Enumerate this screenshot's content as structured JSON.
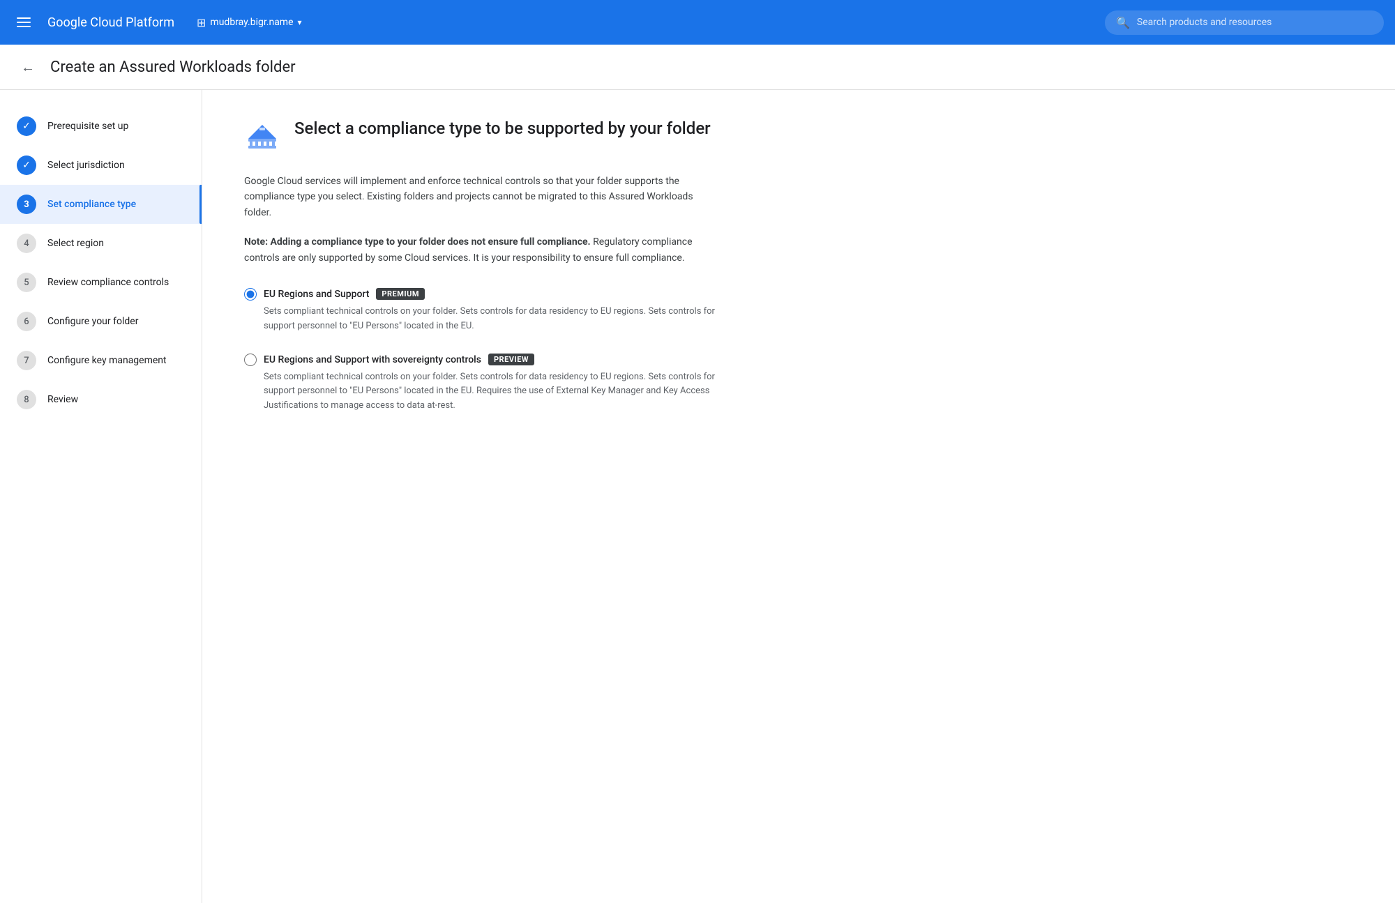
{
  "nav": {
    "hamburger_label": "Menu",
    "logo": "Google Cloud Platform",
    "project_icon": "⊞",
    "project_name": "mudbray.bigr.name",
    "search_placeholder": "Search products and resources"
  },
  "page": {
    "back_label": "←",
    "title": "Create an Assured Workloads folder"
  },
  "sidebar": {
    "items": [
      {
        "id": "1",
        "label": "Prerequisite set up",
        "state": "completed"
      },
      {
        "id": "2",
        "label": "Select jurisdiction",
        "state": "completed"
      },
      {
        "id": "3",
        "label": "Set compliance type",
        "state": "current"
      },
      {
        "id": "4",
        "label": "Select region",
        "state": "pending"
      },
      {
        "id": "5",
        "label": "Review compliance controls",
        "state": "pending"
      },
      {
        "id": "6",
        "label": "Configure your folder",
        "state": "pending"
      },
      {
        "id": "7",
        "label": "Configure key management",
        "state": "pending"
      },
      {
        "id": "8",
        "label": "Review",
        "state": "pending"
      }
    ]
  },
  "content": {
    "title": "Select a compliance type to be supported by your folder",
    "description": "Google Cloud services will implement and enforce technical controls so that your folder supports the compliance type you select. Existing folders and projects cannot be migrated to this Assured Workloads folder.",
    "note": "Note: Adding a compliance type to your folder does not ensure full compliance. Regulatory compliance controls are only supported by some Cloud services. It is your responsibility to ensure full compliance.",
    "options": [
      {
        "id": "eu-regions-support",
        "label": "EU Regions and Support",
        "badge": "PREMIUM",
        "badge_type": "premium",
        "selected": true,
        "description": "Sets compliant technical controls on your folder. Sets controls for data residency to EU regions. Sets controls for support personnel to \"EU Persons\" located in the EU."
      },
      {
        "id": "eu-regions-sovereignty",
        "label": "EU Regions and Support with sovereignty controls",
        "badge": "PREVIEW",
        "badge_type": "preview",
        "selected": false,
        "description": "Sets compliant technical controls on your folder. Sets controls for data residency to EU regions. Sets controls for support personnel to \"EU Persons\" located in the EU. Requires the use of External Key Manager and Key Access Justifications to manage access to data at-rest."
      }
    ]
  }
}
